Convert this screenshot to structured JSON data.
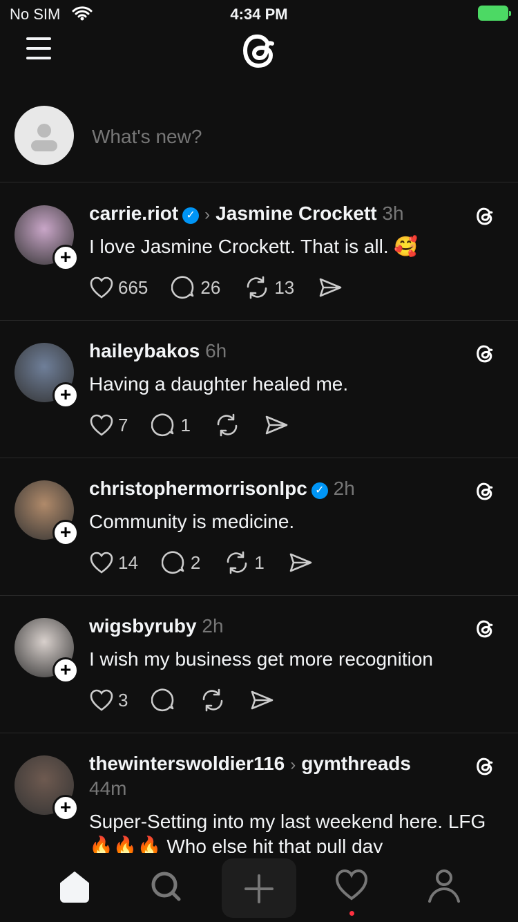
{
  "status": {
    "carrier": "No SIM",
    "time": "4:34 PM"
  },
  "compose": {
    "placeholder": "What's new?"
  },
  "posts": [
    {
      "user": "carrie.riot",
      "verified": true,
      "reply_to": "Jasmine Crockett",
      "time": "3h",
      "text": "I love Jasmine Crockett. That is all. 🥰",
      "likes": "665",
      "replies": "26",
      "reposts": "13",
      "avatar_color": "#c9a6c8"
    },
    {
      "user": "haileybakos",
      "verified": false,
      "reply_to": "",
      "time": "6h",
      "text": "Having a daughter healed me.",
      "likes": "7",
      "replies": "1",
      "reposts": "",
      "avatar_color": "#6f7f99"
    },
    {
      "user": "christophermorrisonlpc",
      "verified": true,
      "reply_to": "",
      "time": "2h",
      "text": "Community is medicine.",
      "likes": "14",
      "replies": "2",
      "reposts": "1",
      "avatar_color": "#b08a6a"
    },
    {
      "user": "wigsbyruby",
      "verified": false,
      "reply_to": "",
      "time": "2h",
      "text": "I wish my business get more recognition",
      "likes": "3",
      "replies": "",
      "reposts": "",
      "avatar_color": "#d8d0cc"
    },
    {
      "user": "thewinterswoldier116",
      "verified": false,
      "reply_to": "gymthreads",
      "time": "44m",
      "text": "Super-Setting into my last weekend here. LFG🔥🔥🔥 Who else hit that pull day",
      "likes": "",
      "replies": "",
      "reposts": "",
      "avatar_color": "#6e5a50"
    }
  ],
  "nav": {
    "items": [
      "home-icon",
      "search-icon",
      "new-thread-icon",
      "activity-icon",
      "profile-icon"
    ],
    "active": "home",
    "notification_color": "#ff3040"
  }
}
